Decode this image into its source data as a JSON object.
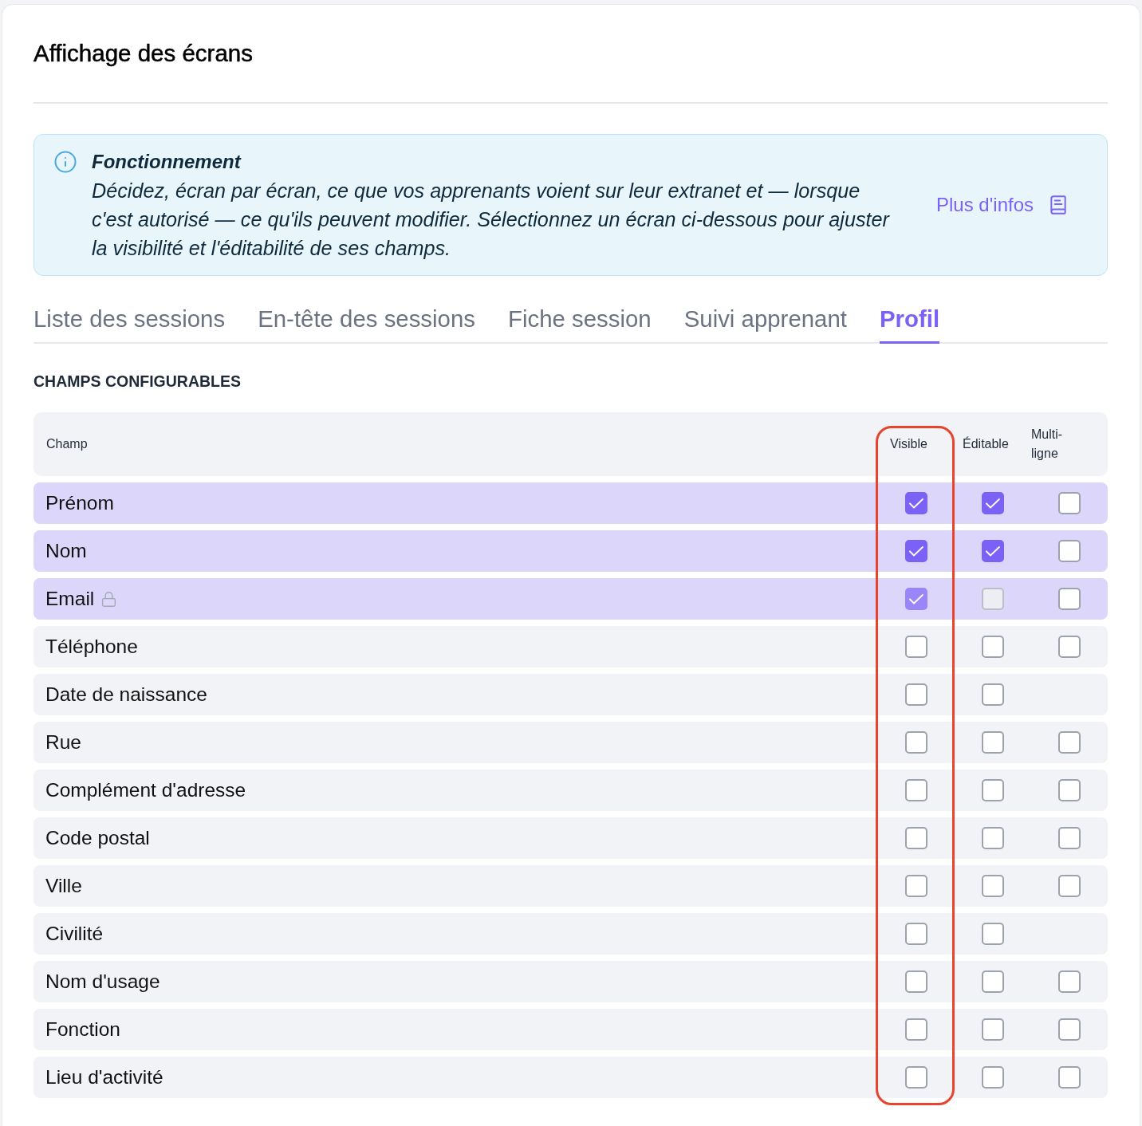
{
  "page": {
    "title": "Affichage des écrans"
  },
  "info": {
    "title": "Fonctionnement",
    "text": "Décidez, écran par écran, ce que vos apprenants voient sur leur extranet et — lorsque c'est autorisé — ce qu'ils peuvent modifier. Sélectionnez un écran ci-dessous pour ajuster la visibilité et l'éditabilité de ses champs.",
    "link": "Plus d'infos"
  },
  "tabs": [
    {
      "label": "Liste des sessions",
      "selected": false
    },
    {
      "label": "En-tête des sessions",
      "selected": false
    },
    {
      "label": "Fiche session",
      "selected": false
    },
    {
      "label": "Suivi apprenant",
      "selected": false
    },
    {
      "label": "Profil",
      "selected": true
    }
  ],
  "section_title": "CHAMPS CONFIGURABLES",
  "table": {
    "columns": [
      {
        "label": "Champ",
        "highlighted": false
      },
      {
        "label": "Visible",
        "highlighted": true
      },
      {
        "label": "Éditable",
        "highlighted": false
      },
      {
        "label": "Multi-ligne",
        "highlighted": false
      }
    ],
    "rows": [
      {
        "label": "Prénom",
        "locked": false,
        "visible": {
          "checked": true,
          "disabled": false
        },
        "editable": {
          "checked": true,
          "disabled": false
        },
        "multiline": {
          "checked": false,
          "disabled": false
        }
      },
      {
        "label": "Nom",
        "locked": false,
        "visible": {
          "checked": true,
          "disabled": false
        },
        "editable": {
          "checked": true,
          "disabled": false
        },
        "multiline": {
          "checked": false,
          "disabled": false
        }
      },
      {
        "label": "Email",
        "locked": true,
        "visible": {
          "checked": true,
          "disabled": true
        },
        "editable": {
          "checked": false,
          "disabled": true
        },
        "multiline": {
          "checked": false,
          "disabled": false
        }
      },
      {
        "label": "Téléphone",
        "locked": false,
        "visible": {
          "checked": false,
          "disabled": false
        },
        "editable": {
          "checked": false,
          "disabled": false
        },
        "multiline": {
          "checked": false,
          "disabled": false
        }
      },
      {
        "label": "Date de naissance",
        "locked": false,
        "visible": {
          "checked": false,
          "disabled": false
        },
        "editable": {
          "checked": false,
          "disabled": false
        }
      },
      {
        "label": "Rue",
        "locked": false,
        "visible": {
          "checked": false,
          "disabled": false
        },
        "editable": {
          "checked": false,
          "disabled": false
        },
        "multiline": {
          "checked": false,
          "disabled": false
        }
      },
      {
        "label": "Complément d'adresse",
        "locked": false,
        "visible": {
          "checked": false,
          "disabled": false
        },
        "editable": {
          "checked": false,
          "disabled": false
        },
        "multiline": {
          "checked": false,
          "disabled": false
        }
      },
      {
        "label": "Code postal",
        "locked": false,
        "visible": {
          "checked": false,
          "disabled": false
        },
        "editable": {
          "checked": false,
          "disabled": false
        },
        "multiline": {
          "checked": false,
          "disabled": false
        }
      },
      {
        "label": "Ville",
        "locked": false,
        "visible": {
          "checked": false,
          "disabled": false
        },
        "editable": {
          "checked": false,
          "disabled": false
        },
        "multiline": {
          "checked": false,
          "disabled": false
        }
      },
      {
        "label": "Civilité",
        "locked": false,
        "visible": {
          "checked": false,
          "disabled": false
        },
        "editable": {
          "checked": false,
          "disabled": false
        }
      },
      {
        "label": "Nom d'usage",
        "locked": false,
        "visible": {
          "checked": false,
          "disabled": false
        },
        "editable": {
          "checked": false,
          "disabled": false
        },
        "multiline": {
          "checked": false,
          "disabled": false
        }
      },
      {
        "label": "Fonction",
        "locked": false,
        "visible": {
          "checked": false,
          "disabled": false
        },
        "editable": {
          "checked": false,
          "disabled": false
        },
        "multiline": {
          "checked": false,
          "disabled": false
        }
      },
      {
        "label": "Lieu d'activité",
        "locked": false,
        "visible": {
          "checked": false,
          "disabled": false
        },
        "editable": {
          "checked": false,
          "disabled": false
        },
        "multiline": {
          "checked": false,
          "disabled": false
        }
      }
    ]
  }
}
